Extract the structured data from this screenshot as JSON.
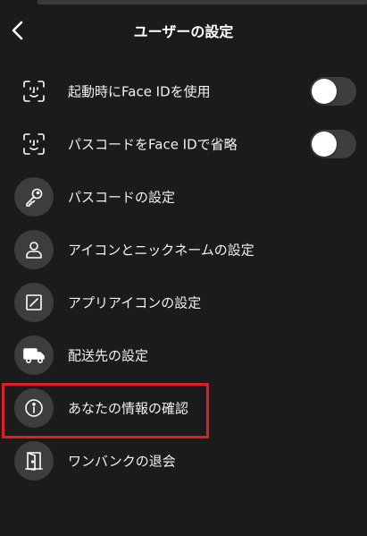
{
  "header": {
    "title": "ユーザーの設定",
    "back_icon": "chevron-left-icon"
  },
  "items": [
    {
      "label": "起動時にFace IDを使用",
      "icon": "face-id-icon",
      "toggle": false
    },
    {
      "label": "パスコードをFace IDで省略",
      "icon": "face-id-icon",
      "toggle": false
    },
    {
      "label": "パスコードの設定",
      "icon": "key-icon"
    },
    {
      "label": "アイコンとニックネームの設定",
      "icon": "person-icon"
    },
    {
      "label": "アプリアイコンの設定",
      "icon": "app-icon-icon"
    },
    {
      "label": "配送先の設定",
      "icon": "truck-icon"
    },
    {
      "label": "あなたの情報の確認",
      "icon": "info-icon",
      "highlighted": true
    },
    {
      "label": "ワンバンクの退会",
      "icon": "exit-door-icon"
    }
  ],
  "colors": {
    "background": "#1b1b1b",
    "icon_circle": "#3d3d3d",
    "toggle_off": "#3e3e3e",
    "highlight": "#e01d24"
  }
}
